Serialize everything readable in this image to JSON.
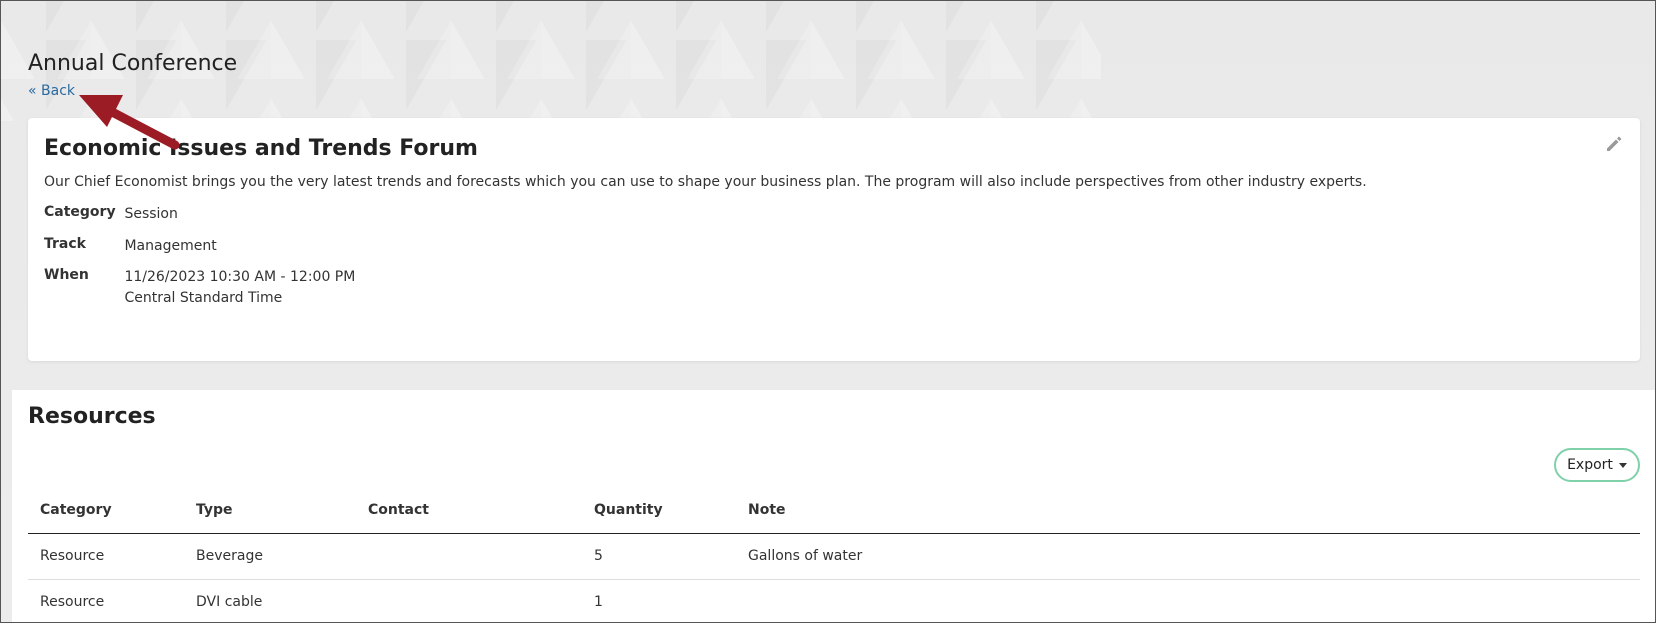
{
  "page": {
    "title": "Annual Conference",
    "back_label": "« Back"
  },
  "session": {
    "title": "Economic Issues and Trends Forum",
    "description": "Our Chief Economist brings you the very latest trends and forecasts which you can use to shape your business plan. The program will also include perspectives from other industry experts.",
    "details": [
      {
        "label": "Category",
        "value": "Session"
      },
      {
        "label": "Track",
        "value": "Management"
      },
      {
        "label": "When",
        "value": "11/26/2023 10:30 AM - 12:00 PM",
        "value2": "Central Standard Time"
      }
    ]
  },
  "resources": {
    "title": "Resources",
    "export_label": "Export",
    "columns": [
      "Category",
      "Type",
      "Contact",
      "Quantity",
      "Note"
    ],
    "rows": [
      [
        "Resource",
        "Beverage",
        "",
        "5",
        "Gallons of water"
      ],
      [
        "Resource",
        "DVI cable",
        "",
        "1",
        ""
      ]
    ]
  },
  "colors": {
    "link": "#2a6aa0",
    "export_border": "#7ed1a8",
    "annotation_arrow": "#9b1c24"
  },
  "icons": {
    "edit": "pencil-icon",
    "dropdown": "caret-down-icon",
    "annotation": "arrow-icon"
  }
}
